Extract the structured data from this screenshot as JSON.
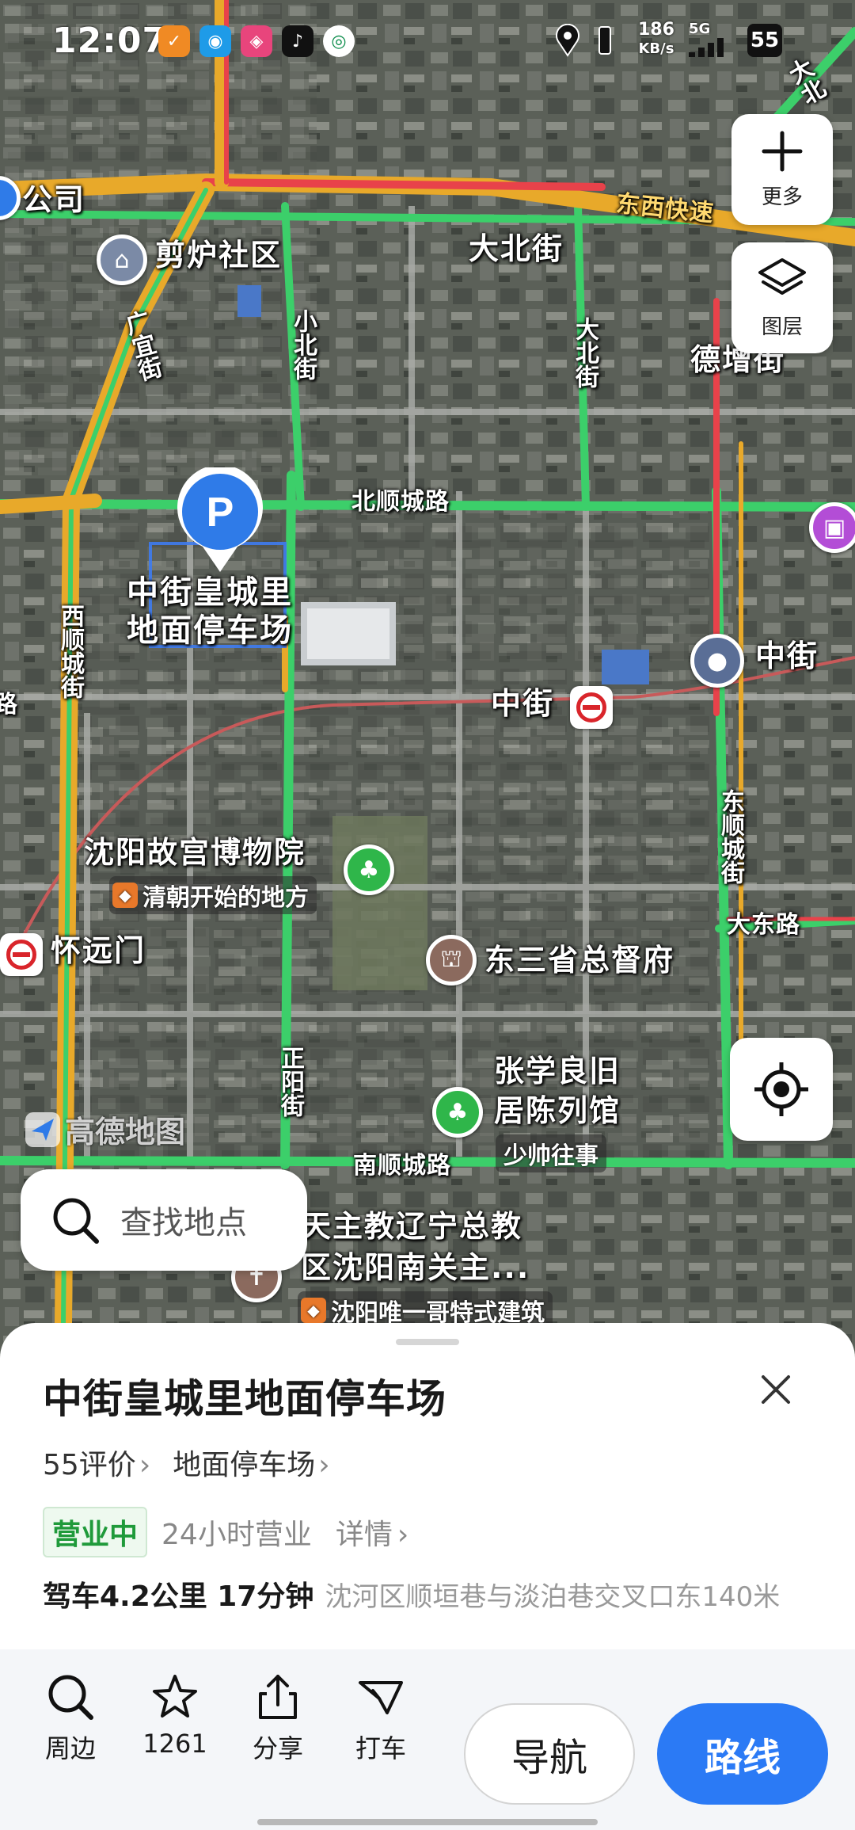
{
  "status_bar": {
    "time": "12:07",
    "speed_value": "186",
    "speed_unit": "KB/s",
    "network": "5G",
    "battery": "55"
  },
  "map": {
    "labels": {
      "company": "公司",
      "jianlu": "剪炉社区",
      "dabeijie": "大北街",
      "dabeijie_v": "大北街",
      "guangyi": "广宜街",
      "xiaobei": "小北街",
      "dezeng": "德增街",
      "dongxi_expressway": "东西快速",
      "dabei_corner": "大北",
      "beishun": "北顺城路",
      "xishun": "西顺城街",
      "zhongjie_station": "中街",
      "zhongjie_area": "中街",
      "museum": "沈阳故宫博物院",
      "museum_sub": "清朝开始的地方",
      "huaiyuan": "怀远门",
      "dongshun": "东顺城街",
      "dadong": "大东路",
      "dusheng": "东三省总督府",
      "zhengyang": "正阳街",
      "zhang_line1": "张学良旧",
      "zhang_line2": "居陈列馆",
      "zhang_sub": "少帅往事",
      "nanshun": "南顺城路",
      "church_line1": "天主教辽宁总教",
      "church_line2": "区沈阳南关主...",
      "church_sub": "沈阳唯一哥特式建筑",
      "left_edge": "路"
    },
    "pin_label_line1": "中街皇城里",
    "pin_label_line2": "地面停车场",
    "pin_icon": "parking-icon",
    "watermark": "高德地图"
  },
  "controls": {
    "more_label": "更多",
    "layers_label": "图层"
  },
  "search": {
    "placeholder": "查找地点"
  },
  "place": {
    "name": "中街皇城里地面停车场",
    "reviews": "55评价",
    "category": "地面停车场",
    "status": "营业中",
    "hours": "24小时营业",
    "details": "详情",
    "drive_info": "驾车4.2公里 17分钟",
    "address": "沈河区顺垣巷与淡泊巷交叉口东140米"
  },
  "actions": {
    "nearby": "周边",
    "favorites": "1261",
    "share": "分享",
    "taxi": "打车",
    "navigate": "导航",
    "route": "路线"
  },
  "colors": {
    "accent": "#2b7af5",
    "open_green": "#1f9a3a",
    "road_green": "#3ccf6a",
    "road_orange": "#e8a92a",
    "road_red": "#e8424a"
  }
}
